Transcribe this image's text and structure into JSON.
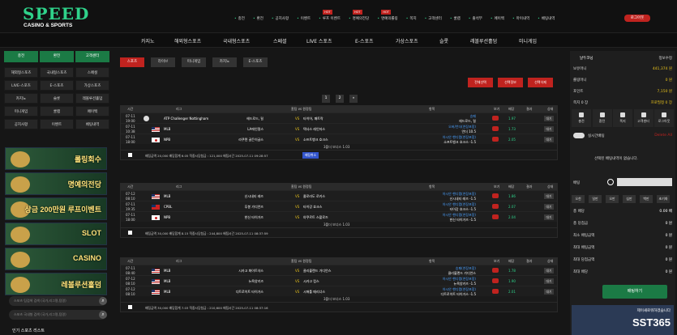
{
  "brand": {
    "logo_top": "SPEED",
    "logo_bottom": "CASINO & SPORTS"
  },
  "topnav": [
    {
      "label": "충전",
      "badge": ""
    },
    {
      "label": "환전",
      "badge": ""
    },
    {
      "label": "공지사항",
      "badge": ""
    },
    {
      "label": "이벤트",
      "badge": ""
    },
    {
      "label": "루프 이벤트",
      "badge": "HOT"
    },
    {
      "label": "명예의전당",
      "badge": "HOT"
    },
    {
      "label": "명예의롤링",
      "badge": "HOT"
    },
    {
      "label": "쪽지",
      "badge": ""
    },
    {
      "label": "고객센터",
      "badge": ""
    },
    {
      "label": "쿨랩",
      "badge": ""
    },
    {
      "label": "출석부",
      "badge": ""
    },
    {
      "label": "페이백",
      "badge": ""
    },
    {
      "label": "마이내역",
      "badge": ""
    },
    {
      "label": "베팅내역",
      "badge": ""
    }
  ],
  "logout": "로그아웃",
  "mainnav": [
    "카지노",
    "해외형스포츠",
    "국내형스포츠",
    "스페셜",
    "LIVE 스포츠",
    "E-스포츠",
    "가상스포츠",
    "슬롯",
    "레볼루션홀덤",
    "미니게임"
  ],
  "left": {
    "actions": [
      "충전",
      "환전",
      "고객센터"
    ],
    "menu": [
      "해외형스포츠",
      "국내형스포츠",
      "스페셜",
      "LIVE-스포츠",
      "E-스포츠",
      "가상스포츠",
      "카지노",
      "슬롯",
      "레볼루션홀덤",
      "미니게임",
      "쿨랩",
      "페이백",
      "공지사항",
      "이벤트",
      "베팅내역"
    ],
    "banners": [
      "롤링회수",
      "명예의전당",
      "상금 200만원 루프이벤트",
      "SLOT",
      "CASINO",
      "레볼루션홀덤"
    ],
    "search1": "스포츠 팀검색 검색 (국가,리그명,팀명)",
    "search2": "스포츠 국내형 검색 (국가,리그명,팀명)",
    "popular": "인기 스포츠 리스트"
  },
  "center": {
    "tabs": [
      "스포츠",
      "라이브",
      "미니게임",
      "카지노",
      "E-스포츠"
    ],
    "actions": [
      "전체선택",
      "선택정보",
      "선택삭제"
    ],
    "pages": [
      "1",
      "2",
      "»"
    ],
    "headers": [
      "시간",
      "리그",
      "홈팀 vs 원정팀",
      "항목",
      "보기",
      "배당",
      "결과",
      "상태"
    ],
    "tables": [
      {
        "rows": [
          {
            "date": "07-11",
            "time": "19:00",
            "flag": "ball",
            "league": "ATP Challenger Nottingham",
            "home": "헤드로드, 릴",
            "away": "타이어, 패트락",
            "item": "승패",
            "item2": "헤드로드, 릴",
            "odds": "1.97",
            "state": "대기"
          },
          {
            "date": "07-11",
            "time": "10:38",
            "flag": "us",
            "league": "MLB",
            "home": "LA에인절스",
            "away": "텍사스 레인저스",
            "item": "오버/언더(연장포함)",
            "item2": "언더 10.5",
            "odds": "1.73",
            "state": "대기"
          },
          {
            "date": "07-11",
            "time": "18:00",
            "flag": "jp",
            "league": "NPB",
            "home": "라쿠텐 골든이글스",
            "away": "소프트뱅크 호크스",
            "item": "아시안 핸디캡(연장포함)",
            "item2": "소프트뱅크 호크스 -1.5",
            "odds": "2.05",
            "state": "대기"
          }
        ],
        "bonus": "3폴더 보너스 1.03",
        "summary": "배팅금액 20,000 배당합계 6.05 적중시당첨금 : 121,000 배팅시간 2025-07-11 09:28:57",
        "cancel": "배팅취소"
      },
      {
        "rows": [
          {
            "date": "07-12",
            "time": "08:10",
            "flag": "us",
            "league": "MLB",
            "home": "신시내티 레즈",
            "away": "콜로라도 로키스",
            "item": "아시안 핸디캡(연장포함)",
            "item2": "신시내티 레즈 -1.5",
            "odds": "1.86",
            "state": "대기"
          },
          {
            "date": "07-11",
            "time": "19:35",
            "flag": "tw",
            "league": "CPBL",
            "home": "푸봉 가디언즈",
            "away": "타이강 호크스",
            "item": "아시안 핸디캡(연장포함)",
            "item2": "타이강 호크스 -1.5",
            "odds": "2.07",
            "state": "대기"
          },
          {
            "date": "07-11",
            "time": "18:00",
            "flag": "jp",
            "league": "NPB",
            "home": "한신 타이거즈",
            "away": "야쿠르트 스왈로즈",
            "item": "아시안 핸디캡(연장포함)",
            "item2": "한신 타이거즈 -1.5",
            "odds": "2.04",
            "state": "대기"
          }
        ],
        "bonus": "3폴더 보너스 1.03",
        "summary": "배팅금액 30,000 배당합계 8.15 적중시당첨금 : 244,800 배팅시간 2025-07-11 08:37:59",
        "cancel": ""
      },
      {
        "rows": [
          {
            "date": "07-11",
            "time": "08:40",
            "flag": "us",
            "league": "MLB",
            "home": "시카고 화이트삭스",
            "away": "클리블랜드 가디언스",
            "item": "승패(연장포함)",
            "item2": "클리블랜드 가디언스",
            "odds": "1.78",
            "state": "대기"
          },
          {
            "date": "07-12",
            "time": "08:10",
            "flag": "us",
            "league": "MLB",
            "home": "뉴욕양키즈",
            "away": "시카고 컵스",
            "item": "아시안 핸디캡(연장포함)",
            "item2": "뉴욕양키즈 -1.5",
            "odds": "1.90",
            "state": "대기"
          },
          {
            "date": "07-12",
            "time": "08:10",
            "flag": "us",
            "league": "MLB",
            "home": "디트로이트 타이거스",
            "away": "시애틀 매리너스",
            "item": "아시안 핸디캡(연장포함)",
            "item2": "디트로이트 타이거스 -1.5",
            "odds": "2.01",
            "state": "대기"
          }
        ],
        "bonus": "3폴더 보너스 1.03",
        "summary": "배팅금액 30,000 배당합계 7.03 적중시당첨금 : 210,600 배팅시간 2025-07-11 08:37:16",
        "cancel": ""
      }
    ]
  },
  "right": {
    "user": "날두코닝",
    "edit": "정보수정",
    "rows": [
      {
        "l": "보유머니",
        "v": "441,374 원"
      },
      {
        "l": "롤링머니",
        "v": "0 원"
      },
      {
        "l": "포인트",
        "v": "7,150 원"
      },
      {
        "l": "쪽지 0 장",
        "v": "프로필정 0 장"
      }
    ],
    "icons": [
      "충전",
      "환전",
      "쪽지",
      "고객센터",
      "로그아웃"
    ],
    "live": "실시간배팅",
    "delete_all": "Delete All",
    "empty": "선택된 배팅내역이 없습니다.",
    "bet_label": "배팅",
    "chips": [
      "오천",
      "일만",
      "오만",
      "십만",
      "백만",
      "초기화"
    ],
    "stats": [
      {
        "l": "총 배당",
        "v": "0.00 배"
      },
      {
        "l": "총 당첨금",
        "v": "0 원"
      },
      {
        "l": "최소 배팅금액",
        "v": "0 원"
      },
      {
        "l": "최대 배팅금액",
        "v": "0 원"
      },
      {
        "l": "최대 당첨금액",
        "v": "0 원"
      },
      {
        "l": "최대 배당",
        "v": "0 원"
      }
    ],
    "bet_button": "배팅하기",
    "promo": "SST365",
    "promo_sub": "제이새로워하겠습니다"
  }
}
